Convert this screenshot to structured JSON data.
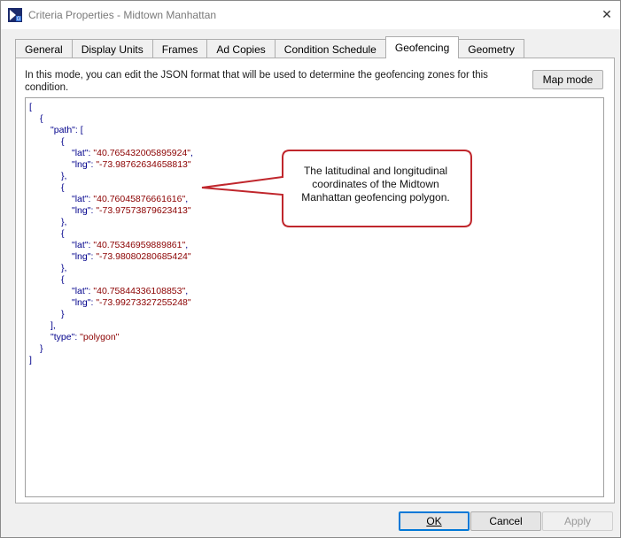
{
  "window": {
    "title": "Criteria Properties - Midtown Manhattan",
    "close_glyph": "✕"
  },
  "tabs": [
    {
      "label": "General"
    },
    {
      "label": "Display Units"
    },
    {
      "label": "Frames"
    },
    {
      "label": "Ad Copies"
    },
    {
      "label": "Condition Schedule"
    },
    {
      "label": "Geofencing",
      "active": true
    },
    {
      "label": "Geometry"
    }
  ],
  "geofencing": {
    "description": "In this mode, you can edit the JSON format that will be used to determine the geofencing zones for this condition.",
    "map_mode_label": "Map mode",
    "json_lines": [
      {
        "indent": 0,
        "parts": [
          {
            "t": "pun",
            "v": "["
          }
        ]
      },
      {
        "indent": 1,
        "parts": [
          {
            "t": "pun",
            "v": "{"
          }
        ]
      },
      {
        "indent": 2,
        "parts": [
          {
            "t": "key",
            "v": "\"path\""
          },
          {
            "t": "pun",
            "v": ": ["
          }
        ]
      },
      {
        "indent": 3,
        "parts": [
          {
            "t": "pun",
            "v": "{"
          }
        ]
      },
      {
        "indent": 4,
        "parts": [
          {
            "t": "key",
            "v": "\"lat\""
          },
          {
            "t": "pun",
            "v": ": "
          },
          {
            "t": "str",
            "v": "\"40.765432005895924\""
          },
          {
            "t": "pun",
            "v": ","
          }
        ]
      },
      {
        "indent": 4,
        "parts": [
          {
            "t": "key",
            "v": "\"lng\""
          },
          {
            "t": "pun",
            "v": ": "
          },
          {
            "t": "str",
            "v": "\"-73.98762634658813\""
          }
        ]
      },
      {
        "indent": 3,
        "parts": [
          {
            "t": "pun",
            "v": "},"
          }
        ]
      },
      {
        "indent": 3,
        "parts": [
          {
            "t": "pun",
            "v": "{"
          }
        ]
      },
      {
        "indent": 4,
        "parts": [
          {
            "t": "key",
            "v": "\"lat\""
          },
          {
            "t": "pun",
            "v": ": "
          },
          {
            "t": "str",
            "v": "\"40.76045876661616\""
          },
          {
            "t": "pun",
            "v": ","
          }
        ]
      },
      {
        "indent": 4,
        "parts": [
          {
            "t": "key",
            "v": "\"lng\""
          },
          {
            "t": "pun",
            "v": ": "
          },
          {
            "t": "str",
            "v": "\"-73.97573879623413\""
          }
        ]
      },
      {
        "indent": 3,
        "parts": [
          {
            "t": "pun",
            "v": "},"
          }
        ]
      },
      {
        "indent": 3,
        "parts": [
          {
            "t": "pun",
            "v": "{"
          }
        ]
      },
      {
        "indent": 4,
        "parts": [
          {
            "t": "key",
            "v": "\"lat\""
          },
          {
            "t": "pun",
            "v": ": "
          },
          {
            "t": "str",
            "v": "\"40.75346959889861\""
          },
          {
            "t": "pun",
            "v": ","
          }
        ]
      },
      {
        "indent": 4,
        "parts": [
          {
            "t": "key",
            "v": "\"lng\""
          },
          {
            "t": "pun",
            "v": ": "
          },
          {
            "t": "str",
            "v": "\"-73.98080280685424\""
          }
        ]
      },
      {
        "indent": 3,
        "parts": [
          {
            "t": "pun",
            "v": "},"
          }
        ]
      },
      {
        "indent": 3,
        "parts": [
          {
            "t": "pun",
            "v": "{"
          }
        ]
      },
      {
        "indent": 4,
        "parts": [
          {
            "t": "key",
            "v": "\"lat\""
          },
          {
            "t": "pun",
            "v": ": "
          },
          {
            "t": "str",
            "v": "\"40.75844336108853\""
          },
          {
            "t": "pun",
            "v": ","
          }
        ]
      },
      {
        "indent": 4,
        "parts": [
          {
            "t": "key",
            "v": "\"lng\""
          },
          {
            "t": "pun",
            "v": ": "
          },
          {
            "t": "str",
            "v": "\"-73.99273327255248\""
          }
        ]
      },
      {
        "indent": 3,
        "parts": [
          {
            "t": "pun",
            "v": "}"
          }
        ]
      },
      {
        "indent": 2,
        "parts": [
          {
            "t": "pun",
            "v": "],"
          }
        ]
      },
      {
        "indent": 2,
        "parts": [
          {
            "t": "key",
            "v": "\"type\""
          },
          {
            "t": "pun",
            "v": ": "
          },
          {
            "t": "str",
            "v": "\"polygon\""
          }
        ]
      },
      {
        "indent": 1,
        "parts": [
          {
            "t": "pun",
            "v": "}"
          }
        ]
      },
      {
        "indent": 0,
        "parts": [
          {
            "t": "pun",
            "v": "]"
          }
        ]
      }
    ]
  },
  "callout": {
    "text": "The latitudinal and longitudinal coordinates of the Midtown Manhattan geofencing polygon.",
    "border_color": "#c0262c"
  },
  "buttons": {
    "ok": "OK",
    "cancel": "Cancel",
    "apply": "Apply"
  },
  "colors": {
    "json_punctuation": "#00008b",
    "json_string": "#8b0000",
    "accent": "#0078d7"
  },
  "icons": {
    "app": "app-logo-icon",
    "close": "close-icon"
  }
}
